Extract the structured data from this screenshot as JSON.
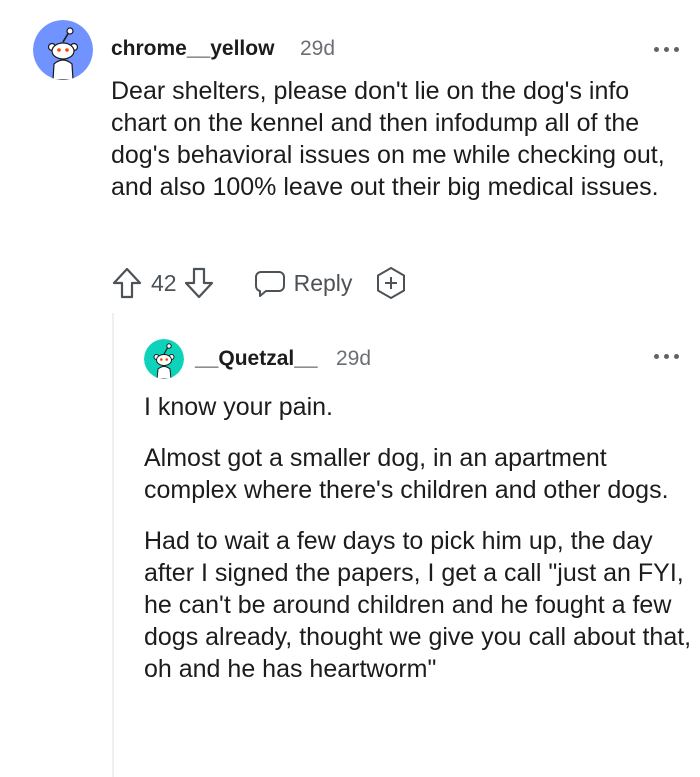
{
  "comments": [
    {
      "username": "chrome__yellow",
      "age": "29d",
      "avatar_icon": "snoo-avatar-icon",
      "avatar_color": "#7193ff",
      "paragraphs": [
        "Dear shelters, please don't lie on the dog's info chart on the kennel and then infodump all of the dog's behavioral issues on me while checking out, and also 100% leave out their big medical issues."
      ],
      "actions": {
        "upvote_icon": "upvote-arrow-icon",
        "score": "42",
        "downvote_icon": "downvote-arrow-icon",
        "reply_icon": "speech-bubble-icon",
        "reply_label": "Reply",
        "award_icon": "plus-badge-icon"
      }
    },
    {
      "username": "__Quetzal__",
      "age": "29d",
      "avatar_icon": "snoo-avatar-icon",
      "avatar_color": "#0dd3bb",
      "paragraphs": [
        "I know your pain.",
        "Almost got a smaller dog, in an apartment complex where there's children and other dogs.",
        "Had to wait a few days to pick him up, the day after I signed the papers, I get a call \"just an FYI, he can't be around children and he fought a few dogs already, thought we give you call about that, oh and he has heartworm\""
      ]
    }
  ],
  "more_icon": "more-options-icon"
}
